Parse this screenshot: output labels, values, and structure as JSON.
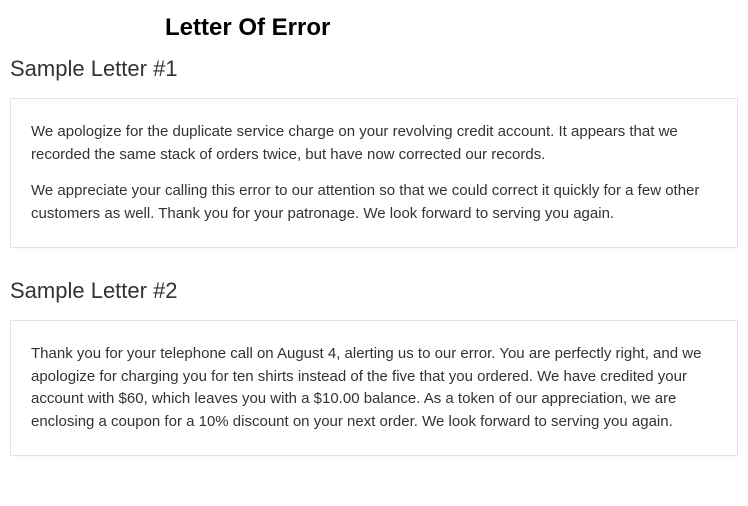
{
  "page_title": "Letter Of Error",
  "sections": [
    {
      "heading": "Sample Letter #1",
      "paragraphs": [
        "We apologize for the duplicate service charge on your revolving credit account. It appears that we recorded the same stack of orders twice, but have now corrected our records.",
        "We appreciate your calling this error to our attention so that we could correct it quickly for a few other customers as well. Thank you for your patronage. We look forward to serving you again."
      ]
    },
    {
      "heading": "Sample Letter #2",
      "paragraphs": [
        "Thank you for your telephone call on August 4, alerting us to our error. You are perfectly right, and we apologize for charging you for ten shirts instead of the five that you ordered. We have credited your account with $60, which leaves you with a $10.00 balance. As a token of our appreciation, we are enclosing a coupon for a 10% discount on your next order. We look forward to serving you again."
      ]
    }
  ]
}
